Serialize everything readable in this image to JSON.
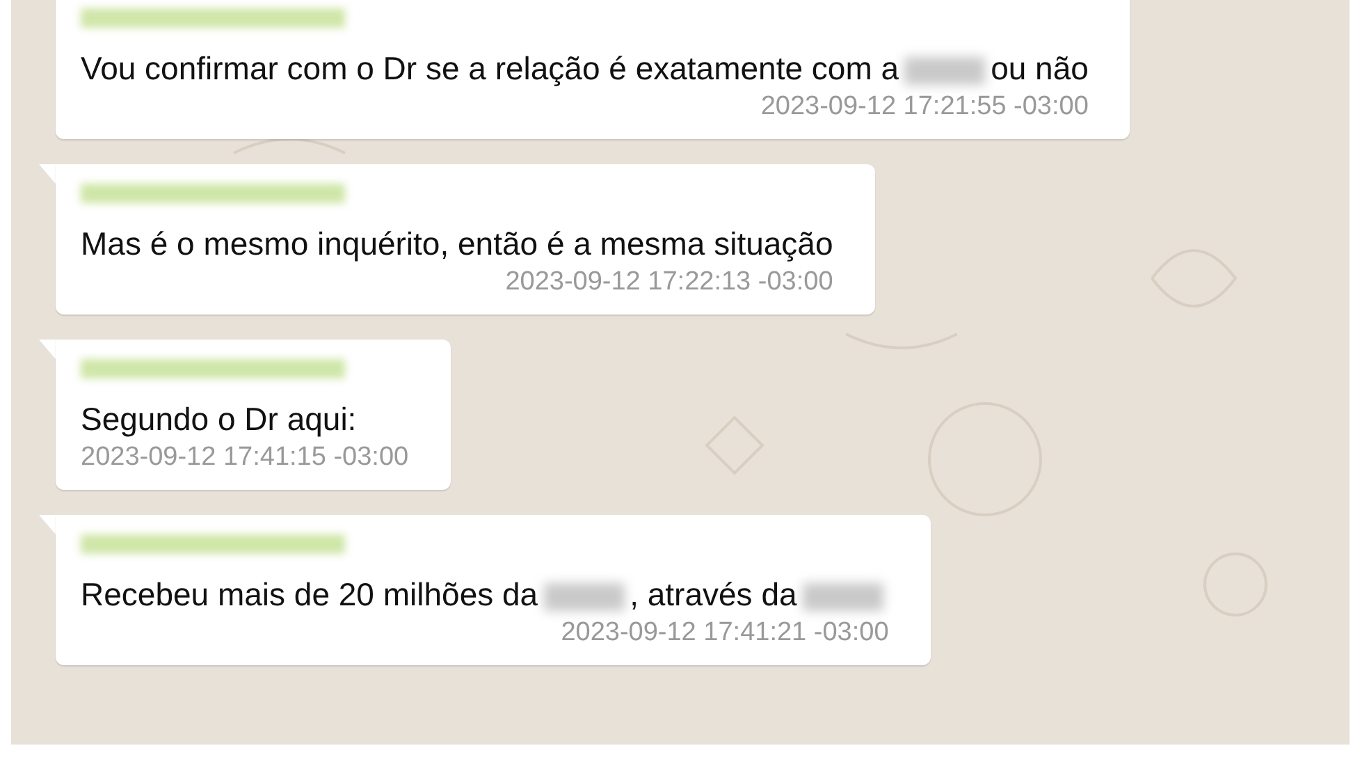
{
  "messages": [
    {
      "sender_hidden": true,
      "parts": [
        {
          "kind": "text",
          "text": "Vou confirmar com o Dr se a relação é exatamente com a"
        },
        {
          "kind": "redacted"
        },
        {
          "kind": "text",
          "text": "ou não"
        }
      ],
      "time": "2023-09-12 17:21:55 -03:00"
    },
    {
      "sender_hidden": true,
      "parts": [
        {
          "kind": "text",
          "text": "Mas é o mesmo inquérito, então é a mesma situação"
        }
      ],
      "time": "2023-09-12 17:22:13 -03:00"
    },
    {
      "sender_hidden": true,
      "parts": [
        {
          "kind": "text",
          "text": "Segundo o Dr aqui:"
        }
      ],
      "time": "2023-09-12 17:41:15 -03:00"
    },
    {
      "sender_hidden": true,
      "parts": [
        {
          "kind": "text",
          "text": "Recebeu mais de 20 milhões da"
        },
        {
          "kind": "redacted"
        },
        {
          "kind": "text",
          "text": ", através da"
        },
        {
          "kind": "redacted"
        }
      ],
      "time": "2023-09-12 17:41:21 -03:00"
    }
  ]
}
